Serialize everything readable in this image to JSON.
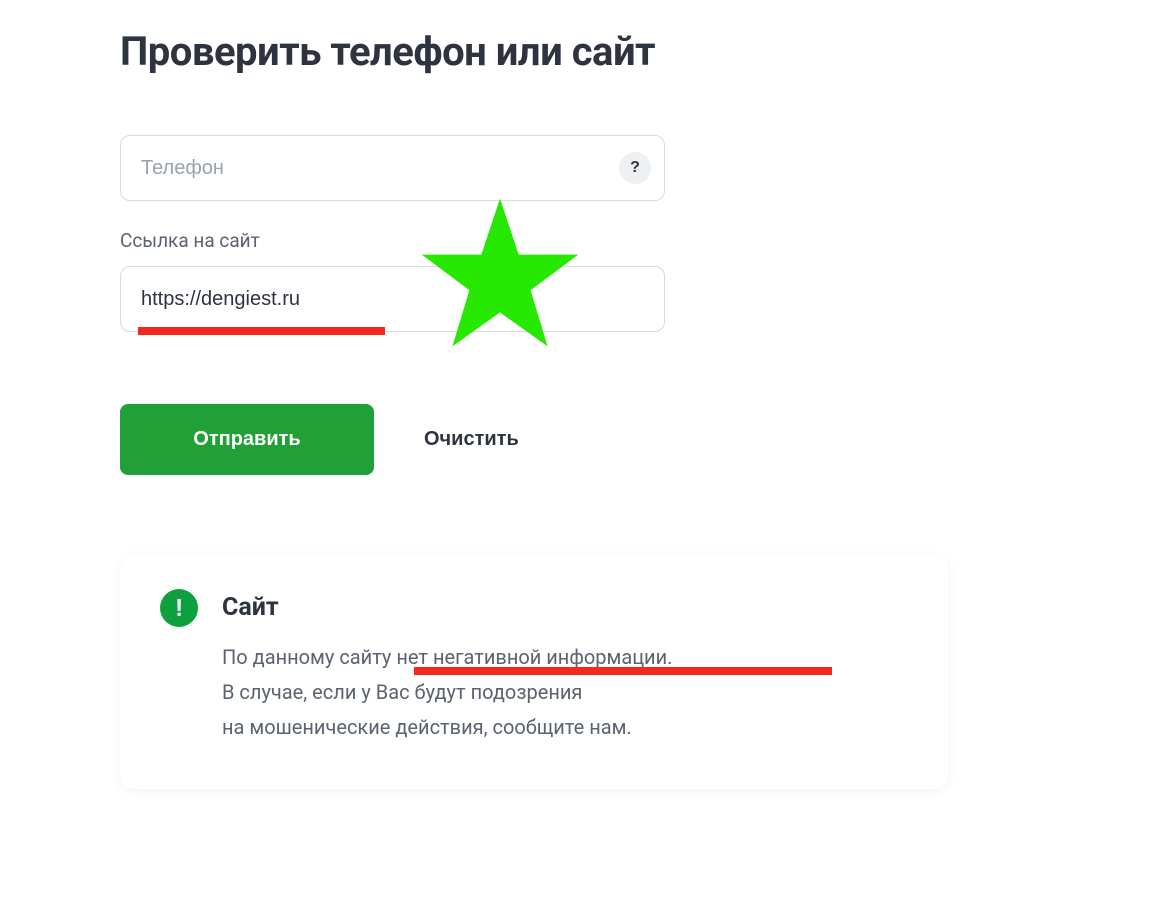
{
  "page": {
    "title": "Проверить телефон или сайт"
  },
  "form": {
    "phone": {
      "placeholder": "Телефон",
      "value": "",
      "help_symbol": "?"
    },
    "url": {
      "label": "Ссылка на сайт",
      "value": "https://dengiest.ru"
    },
    "submit_label": "Отправить",
    "clear_label": "Очистить"
  },
  "result": {
    "status_mark": "!",
    "title": "Сайт",
    "text": "По данному сайту нет негативной информации.\nВ случае, если у Вас будут подозрения\nна мошенические действия, сообщите нам."
  },
  "annotations": {
    "star_color": "#26e800",
    "underline_color": "#f4291e"
  }
}
